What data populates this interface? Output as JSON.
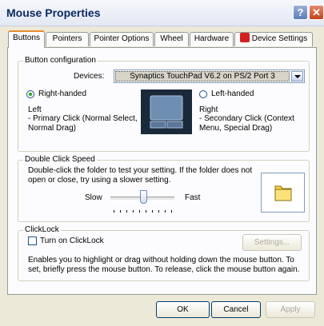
{
  "window": {
    "title": "Mouse Properties"
  },
  "tabs": [
    {
      "label": "Buttons"
    },
    {
      "label": "Pointers"
    },
    {
      "label": "Pointer Options"
    },
    {
      "label": "Wheel"
    },
    {
      "label": "Hardware"
    },
    {
      "label": "Device Settings"
    }
  ],
  "button_config": {
    "legend": "Button configuration",
    "devices_label": "Devices:",
    "devices_value": "Synaptics TouchPad V6.2 on PS/2 Port 3",
    "right_handed": "Right-handed",
    "left_handed": "Left-handed",
    "left_title": "Left",
    "left_desc": "- Primary Click (Normal Select, Normal Drag)",
    "right_title": "Right",
    "right_desc": "- Secondary Click (Context Menu, Special Drag)"
  },
  "double_click": {
    "legend": "Double Click Speed",
    "desc": "Double-click the folder to test your setting.  If the folder does not open or close, try using a slower setting.",
    "slow": "Slow",
    "fast": "Fast",
    "speed_level": 0.45
  },
  "clicklock": {
    "legend": "ClickLock",
    "checkbox": "Turn on ClickLock",
    "settings_btn": "Settings...",
    "desc": "Enables you to highlight or drag without holding down the mouse button.  To set, briefly press the mouse button.  To release, click the mouse button again."
  },
  "footer": {
    "ok": "OK",
    "cancel": "Cancel",
    "apply": "Apply"
  },
  "colors": {
    "accent": "#e68b2c",
    "window_bg": "#ece9d8",
    "title_text": "#0b2a63"
  }
}
